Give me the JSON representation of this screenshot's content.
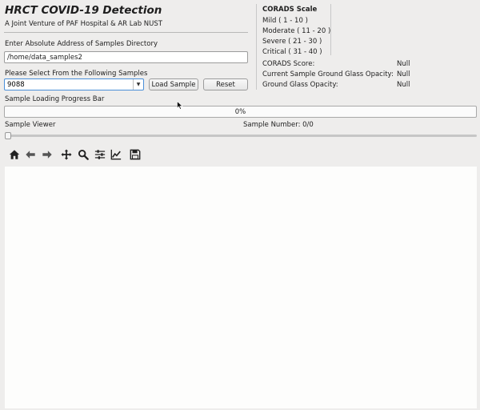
{
  "header": {
    "title": "HRCT COVID-19 Detection",
    "subtitle": "A Joint Venture of PAF Hospital & AR Lab NUST"
  },
  "directory": {
    "label": "Enter Absolute Address of Samples Directory",
    "value": "/home/data_samples2"
  },
  "samples": {
    "label": "Please Select From the Following Samples",
    "selected": "9088"
  },
  "buttons": {
    "load": "Load Sample",
    "reset": "Reset"
  },
  "corads": {
    "title": "CORADS Scale",
    "scale": [
      "Mild ( 1 - 10 )",
      "Moderate ( 11 - 20 )",
      "Severe ( 21 - 30 )",
      "Critical ( 31 - 40 )"
    ],
    "info": [
      {
        "label": "CORADS Score:",
        "value": "Null"
      },
      {
        "label": "Current Sample Ground Glass Opacity:",
        "value": "Null"
      },
      {
        "label": "Ground Glass Opacity:",
        "value": "Null"
      }
    ]
  },
  "progress": {
    "label": "Sample Loading Progress Bar",
    "fraction": 0,
    "text": "0%"
  },
  "viewer": {
    "label": "Sample Viewer",
    "sample_number": "Sample Number: 0/0",
    "slider_position": 0
  },
  "toolbar": {
    "icons": [
      "home-icon",
      "back-arrow-icon",
      "forward-arrow-icon",
      "pan-icon",
      "zoom-icon",
      "configure-subplots-icon",
      "edit-axis-icon",
      "save-icon"
    ]
  },
  "colors": {
    "accent": "#3a85d6",
    "background": "#eeedec",
    "canvas": "#fdfdfc"
  }
}
